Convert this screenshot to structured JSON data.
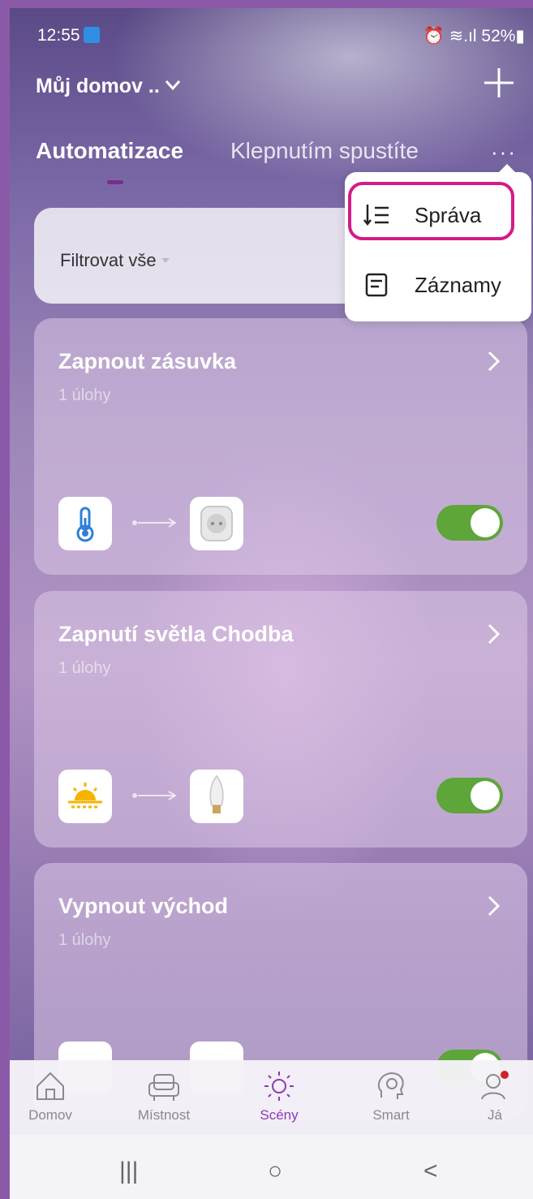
{
  "status_bar": {
    "time": "12:55",
    "right": "⏰ ≋.ıl 52%▮"
  },
  "header": {
    "home_title": "Můj domov ..",
    "add_icon": "plus-icon"
  },
  "tabs": {
    "active": "Automatizace",
    "inactive": "Klepnutím spustíte",
    "more": "···"
  },
  "filter": {
    "label": "Filtrovat vše"
  },
  "menu": {
    "items": [
      {
        "label": "Správa",
        "icon": "sort-icon"
      },
      {
        "label": "Záznamy",
        "icon": "log-icon"
      }
    ]
  },
  "automations": [
    {
      "title": "Zapnout zásuvka",
      "tasks": "1 úlohy",
      "condition_icon": "thermometer-icon",
      "action_icon": "smart-plug-icon",
      "enabled": true
    },
    {
      "title": "Zapnutí světla Chodba",
      "tasks": "1 úlohy",
      "condition_icon": "sunrise-icon",
      "action_icon": "bulb-icon",
      "enabled": true
    },
    {
      "title": "Vypnout východ",
      "tasks": "1 úlohy",
      "condition_icon": "sunrise-icon",
      "action_icon": "bulb-icon",
      "enabled": true
    }
  ],
  "bottom_nav": [
    {
      "label": "Domov",
      "icon": "house-icon"
    },
    {
      "label": "Místnost",
      "icon": "armchair-icon"
    },
    {
      "label": "Scény",
      "icon": "sun-icon",
      "active": true
    },
    {
      "label": "Smart",
      "icon": "brain-icon"
    },
    {
      "label": "Já",
      "icon": "user-icon"
    }
  ],
  "system_nav": {
    "recents": "|||",
    "home": "○",
    "back": "<"
  },
  "colors": {
    "accent": "#8e39b4",
    "toggle_on": "#5ea53a",
    "highlight": "#d51a8a"
  }
}
